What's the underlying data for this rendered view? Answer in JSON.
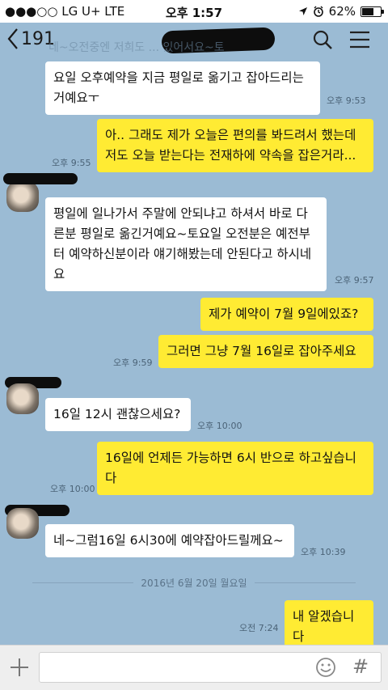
{
  "status_bar": {
    "carrier": "●●●○○ LG U+  LTE",
    "time": "오후 1:57",
    "battery": "62%",
    "battery_level": 0.62
  },
  "header": {
    "back_label": "191",
    "bleed_text": "네~오전중엔 저희도 ... 있어서요~토"
  },
  "messages": [
    {
      "dir": "in",
      "text": "요일 오후예약을 지금 평일로 옮기고 잡아드리는 거예요ㅜ",
      "time": "오후 9:53"
    },
    {
      "dir": "out",
      "text": "아.. 그래도 제가 오늘은 편의를 봐드려서 했는데 저도 오늘 받는다는 전재하에 약속을 잡은거라...",
      "time": "오후 9:55"
    },
    {
      "dir": "in",
      "text": "평일에 일나가서 주말에 안되냐고 하셔서 바로 다른분 평일로 옮긴거예요~토요일 오전분은 예전부터 예약하신분이라 얘기해봤는데 안된다고 하시네요",
      "time": "오후 9:57"
    },
    {
      "dir": "out",
      "text": "제가 예약이 7월 9일에있죠?",
      "time": ""
    },
    {
      "dir": "out",
      "text": "그러면 그냥  7월 16일로 잡아주세요",
      "time": "오후 9:59"
    },
    {
      "dir": "in",
      "text": "16일 12시 괜찮으세요?",
      "time": "오후 10:00"
    },
    {
      "dir": "out",
      "text": "16일에 언제든 가능하면 6시 반으로 하고싶습니다",
      "time": "오후 10:00"
    },
    {
      "dir": "in",
      "text": "네~그럼16일 6시30에 예약잡아드릴께요~",
      "time": "오후 10:39"
    },
    {
      "dir": "out",
      "text": "내 알겠습니다",
      "time": "오전 7:24"
    }
  ],
  "date_divider": "2016년 6월 20일 월요일",
  "input": {
    "placeholder": ""
  },
  "icons": [
    "back-chevron-icon",
    "search-icon",
    "menu-icon",
    "plus-icon",
    "emoji-icon",
    "hash-icon",
    "location-icon",
    "alarm-icon",
    "battery-icon"
  ]
}
